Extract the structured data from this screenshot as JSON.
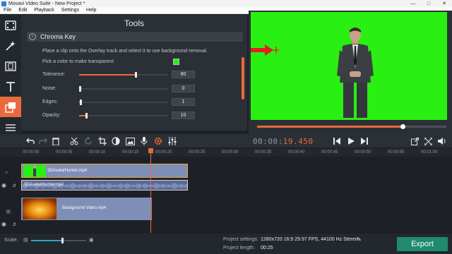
{
  "window": {
    "title": "Movavi Video Suite - New Project *"
  },
  "menu": [
    "File",
    "Edit",
    "Playback",
    "Settings",
    "Help"
  ],
  "left_toolbar": [
    "import-icon",
    "magic-wand-icon",
    "filmstrip-icon",
    "title-text-icon",
    "overlay-icon",
    "menu-lines-icon"
  ],
  "tools": {
    "title": "Tools",
    "section": "Chroma Key",
    "hint": "Place a clip onto the Overlay track and select it to use background removal.",
    "pick_label": "Pick a color to make transparent:",
    "pick_color": "#2aef12",
    "params": [
      {
        "label": "Tolerance:",
        "value": "80",
        "level": 0.63
      },
      {
        "label": "Noise:",
        "value": "0",
        "level": 0.0
      },
      {
        "label": "Edges:",
        "value": "1",
        "level": 0.01
      },
      {
        "label": "Opacity:",
        "value": "10",
        "level": 0.07
      }
    ]
  },
  "preview": {
    "progress": 0.77
  },
  "playback": {
    "time_main": "00:00:",
    "time_ms": "19.450"
  },
  "ruler": [
    "00:00:00",
    "00:00:05",
    "00:00:10",
    "00:00:15",
    "00:00:20",
    "00:00:25",
    "00:00:30",
    "00:00:35",
    "00:00:40",
    "00:00:45",
    "00:00:50",
    "00:00:55",
    "00:01:00"
  ],
  "timeline": {
    "overlay_clip": "3DAvatarHunter.mp4",
    "audio_clip": "3DAvatarHunter.mp4",
    "background_clip": "Background Video.mp4"
  },
  "bottom": {
    "scale_label": "Scale:",
    "scale_level": 0.55,
    "project_settings_label": "Project settings:",
    "project_settings_value": "1280x720 16:9 29.97 FPS, 44100 Hz Stereo",
    "project_length_label": "Project length:",
    "project_length_value": "00:25",
    "export_label": "Export"
  },
  "colors": {
    "accent": "#e86a3e",
    "chroma_green": "#2aef12",
    "export": "#1f8a70"
  }
}
